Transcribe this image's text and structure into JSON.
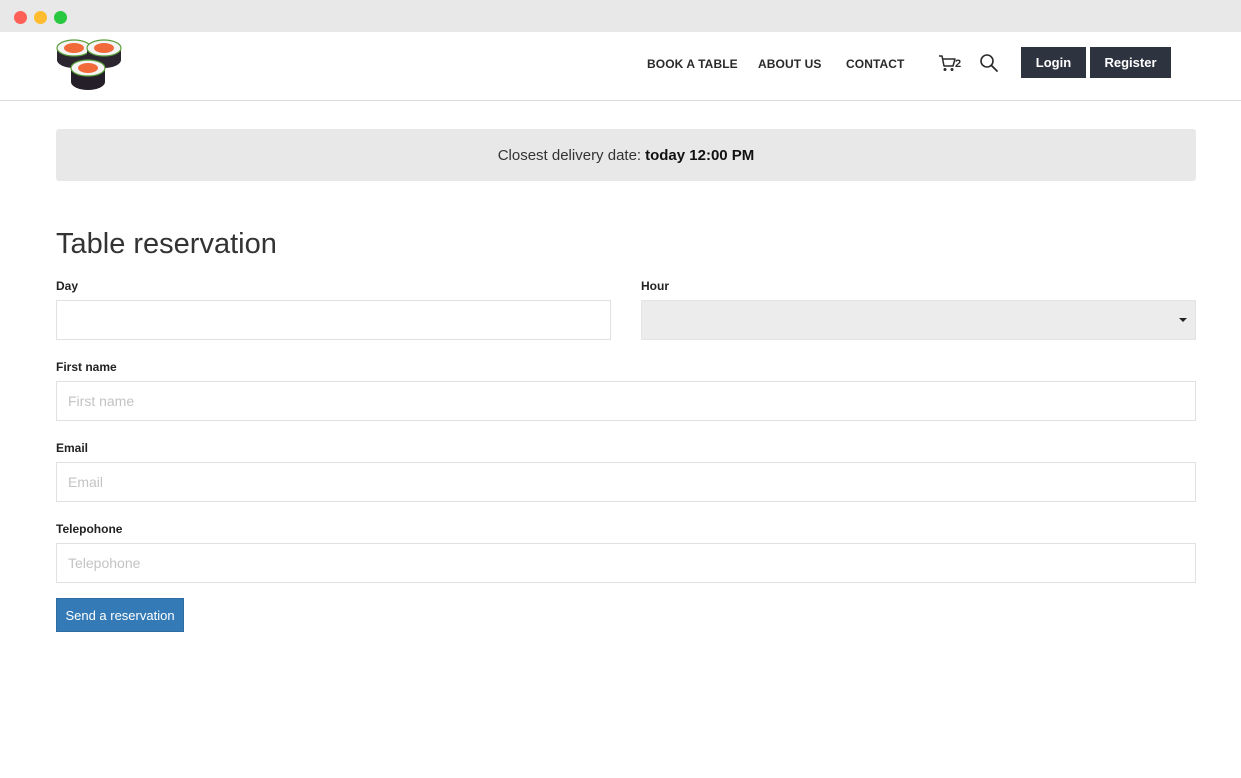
{
  "header": {
    "nav": [
      {
        "label": "BOOK A TABLE"
      },
      {
        "label": "ABOUT US"
      },
      {
        "label": "CONTACT"
      }
    ],
    "cart_count": "2",
    "login_label": "Login",
    "register_label": "Register",
    "icons": {
      "logo": "sushi-logo",
      "cart": "cart-icon",
      "search": "search-icon"
    }
  },
  "banner": {
    "prefix": "Closest delivery date:",
    "value": "today 12:00 PM"
  },
  "form": {
    "title": "Table reservation",
    "day": {
      "label": "Day",
      "value": "",
      "placeholder": ""
    },
    "hour": {
      "label": "Hour",
      "value": ""
    },
    "first_name": {
      "label": "First name",
      "placeholder": "First name"
    },
    "email": {
      "label": "Email",
      "placeholder": "Email"
    },
    "telephone": {
      "label": "Telepohone",
      "placeholder": "Telepohone"
    },
    "submit_label": "Send a reservation"
  },
  "colors": {
    "dark_button": "#2d3440",
    "primary_button": "#337ab7",
    "banner_bg": "#e8e8e8"
  }
}
